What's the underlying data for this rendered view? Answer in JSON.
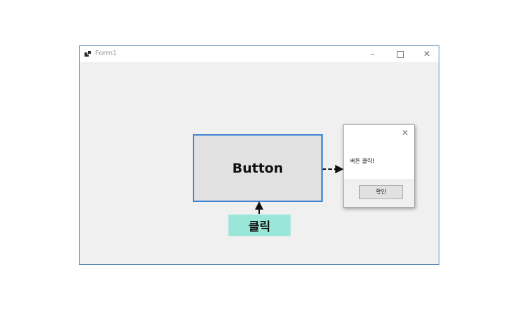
{
  "window": {
    "title": "Form1",
    "controls": {
      "minimize": "–",
      "maximize": "",
      "close": "✕"
    }
  },
  "form": {
    "button_label": "Button",
    "click_label": "클릭"
  },
  "dialog": {
    "close": "✕",
    "message": "버튼 클릭!",
    "ok_label": "확인"
  },
  "colors": {
    "window_border": "#5b86b8",
    "button_border": "#3f84d1",
    "click_label_bg": "#99e7d9"
  }
}
